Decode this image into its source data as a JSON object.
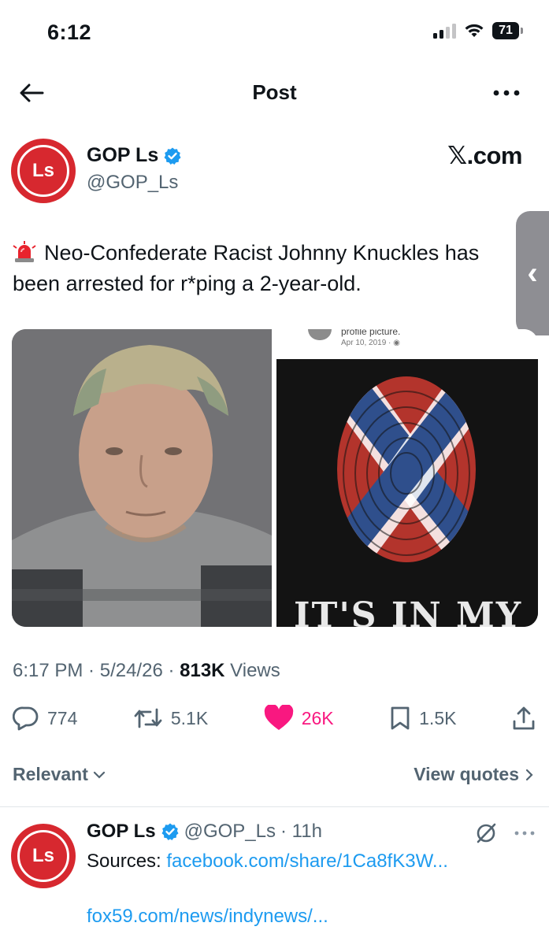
{
  "status_bar": {
    "time": "6:12",
    "battery": "71"
  },
  "header": {
    "title": "Post"
  },
  "post": {
    "author_name": "GOP Ls",
    "author_handle": "@GOP_Ls",
    "avatar_text": "Ls",
    "brand": "𝕏.com",
    "text": "Neo-Confederate Racist Johnny Knuckles has been arrested for r*ping a 2-year-old.",
    "images": {
      "right_caption_line1": "profile picture.",
      "right_caption_line2": "Apr 10, 2019 · ◉",
      "shirt_text": "IT'S IN MY"
    },
    "time": "6:17 PM",
    "date": "5/24/26",
    "views_count": "813K",
    "views_label": "Views",
    "replies": "774",
    "reposts": "5.1K",
    "likes": "26K",
    "bookmarks": "1.5K"
  },
  "filter": {
    "label": "Relevant",
    "view_quotes": "View quotes"
  },
  "reply": {
    "author_name": "GOP Ls",
    "author_handle": "@GOP_Ls",
    "age": "· 11h",
    "sources_label": "Sources:",
    "link1": "facebook.com/share/1Ca8fK3W...",
    "link2": "fox59.com/news/indynews/..."
  },
  "colors": {
    "accent": "#1d9bf0",
    "like": "#f91880",
    "secondary_text": "#536471",
    "avatar_red": "#d7282f"
  }
}
